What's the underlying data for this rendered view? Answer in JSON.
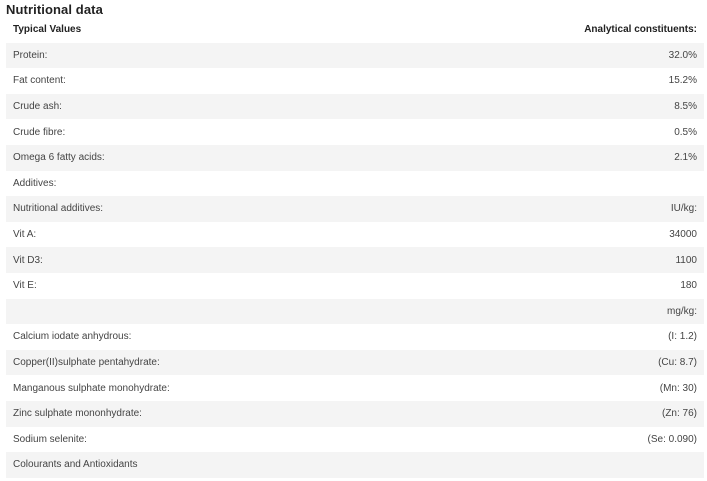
{
  "section": {
    "title": "Nutritional data"
  },
  "table": {
    "header": {
      "label": "Typical Values",
      "value": "Analytical constituents:"
    },
    "rows": [
      {
        "label": "Protein:",
        "value": "32.0%"
      },
      {
        "label": "Fat content:",
        "value": "15.2%"
      },
      {
        "label": "Crude ash:",
        "value": "8.5%"
      },
      {
        "label": "Crude fibre:",
        "value": "0.5%"
      },
      {
        "label": "Omega 6 fatty acids:",
        "value": "2.1%"
      },
      {
        "label": "Additives:",
        "value": ""
      },
      {
        "label": "Nutritional additives:",
        "value": "IU/kg:"
      },
      {
        "label": "Vit A:",
        "value": "34000"
      },
      {
        "label": "Vit D3:",
        "value": "1100"
      },
      {
        "label": "Vit E:",
        "value": "180"
      },
      {
        "label": "",
        "value": "mg/kg:"
      },
      {
        "label": "Calcium iodate anhydrous:",
        "value": "(I: 1.2)"
      },
      {
        "label": "Copper(II)sulphate pentahydrate:",
        "value": "(Cu: 8.7)"
      },
      {
        "label": "Manganous sulphate monohydrate:",
        "value": "(Mn: 30)"
      },
      {
        "label": "Zinc sulphate mononhydrate:",
        "value": "(Zn: 76)"
      },
      {
        "label": "Sodium selenite:",
        "value": "(Se: 0.090)"
      },
      {
        "label": "Colourants and Antioxidants",
        "value": ""
      }
    ]
  }
}
